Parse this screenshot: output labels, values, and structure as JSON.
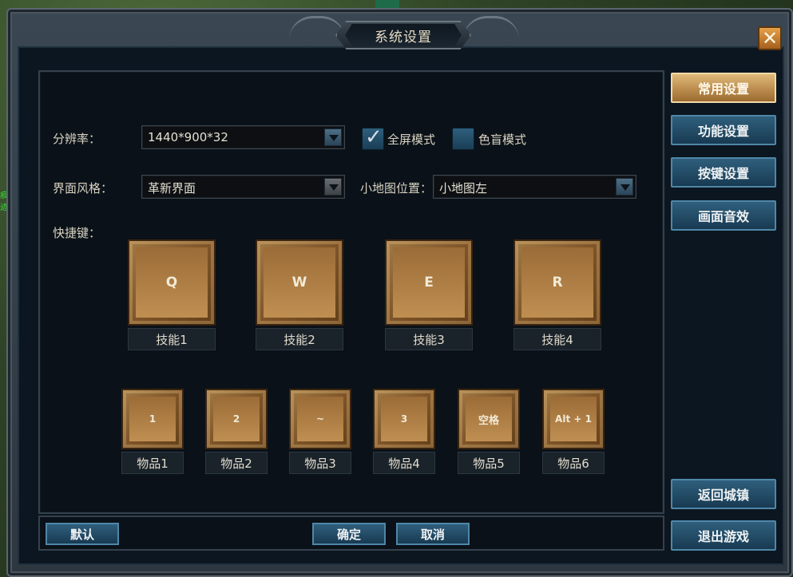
{
  "window": {
    "title": "系统设置",
    "close_glyph": "✕"
  },
  "settings": {
    "resolution": {
      "label": "分辨率：",
      "value": "1440*900*32"
    },
    "fullscreen": {
      "label": "全屏模式",
      "checked": true
    },
    "colorblind": {
      "label": "色盲模式",
      "checked": false
    },
    "ui_style": {
      "label": "界面风格：",
      "value": "革新界面"
    },
    "minimap": {
      "label": "小地图位置：",
      "value": "小地图左"
    },
    "hotkeys_label": "快捷键："
  },
  "skills": [
    {
      "key": "Q",
      "name": "技能1"
    },
    {
      "key": "W",
      "name": "技能2"
    },
    {
      "key": "E",
      "name": "技能3"
    },
    {
      "key": "R",
      "name": "技能4"
    }
  ],
  "items": [
    {
      "key": "1",
      "name": "物品1"
    },
    {
      "key": "2",
      "name": "物品2"
    },
    {
      "key": "~",
      "name": "物品3"
    },
    {
      "key": "3",
      "name": "物品4"
    },
    {
      "key": "空格",
      "name": "物品5"
    },
    {
      "key": "Alt + 1",
      "name": "物品6"
    }
  ],
  "tabs": [
    {
      "label": "常用设置",
      "active": true
    },
    {
      "label": "功能设置",
      "active": false
    },
    {
      "label": "按键设置",
      "active": false
    },
    {
      "label": "画面音效",
      "active": false
    }
  ],
  "side_actions": {
    "return_town": "返回城镇",
    "exit_game": "退出游戏"
  },
  "footer": {
    "default": "默认",
    "confirm": "确定",
    "cancel": "取消"
  },
  "background": {
    "left_marker": "痕迹"
  },
  "colors": {
    "accent_gold": "#c8955a",
    "button_blue": "#2f5f7c",
    "panel_bg": "#0a1118"
  }
}
